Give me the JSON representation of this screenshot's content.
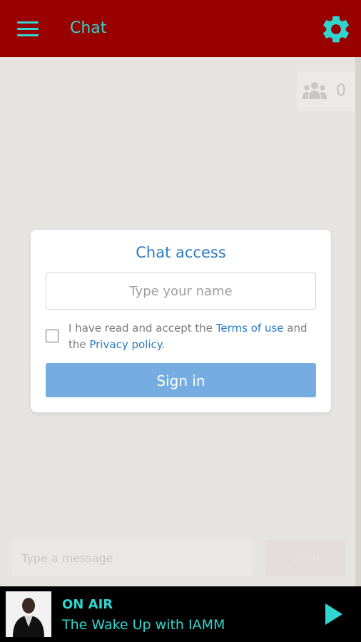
{
  "header": {
    "title": "Chat",
    "menu_icon": "hamburger-menu-icon",
    "settings_icon": "gear-icon"
  },
  "users": {
    "icon": "users-group-icon",
    "count": "0"
  },
  "dialog": {
    "title": "Chat access",
    "name_placeholder": "Type your name",
    "terms_prefix": "I have read and accept the ",
    "terms_link": "Terms of use",
    "terms_middle": " and the ",
    "privacy_link": "Privacy policy",
    "terms_suffix": ".",
    "signin_label": "Sign in"
  },
  "composer": {
    "placeholder": "Type a message",
    "send_label": "Send"
  },
  "player": {
    "status": "ON AIR",
    "track": "The Wake Up with IAMM",
    "play_icon": "play-icon"
  },
  "colors": {
    "header_bg": "#990000",
    "accent": "#2fd6d0",
    "link": "#2b7bc2",
    "button": "#76ade0"
  }
}
